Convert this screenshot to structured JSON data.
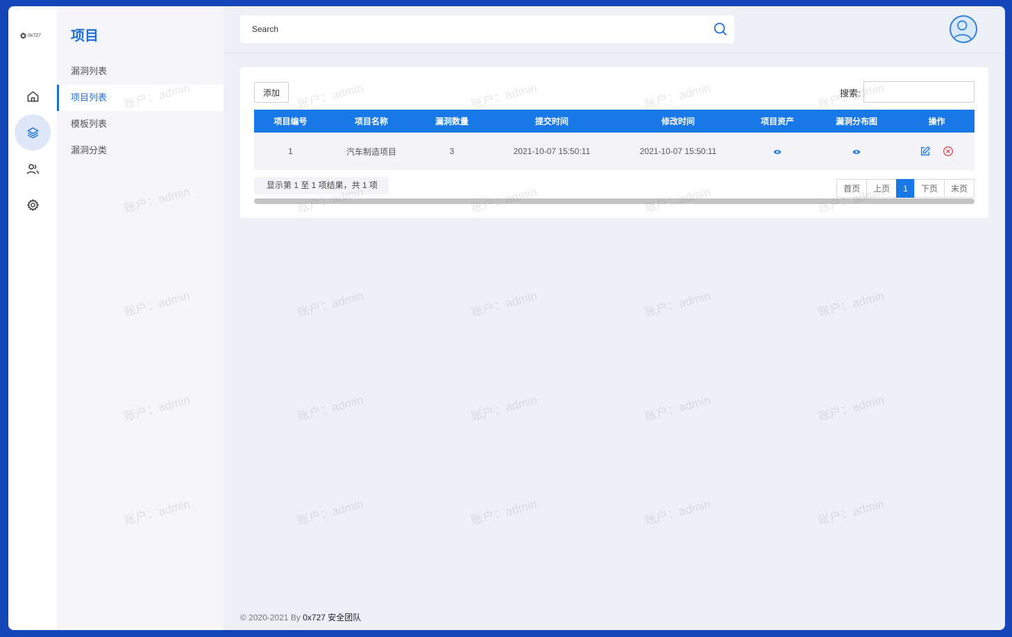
{
  "logo": {
    "text": "0x727"
  },
  "rail": [
    {
      "name": "home-icon",
      "active": false
    },
    {
      "name": "layers-icon",
      "active": true
    },
    {
      "name": "users-icon",
      "active": false
    },
    {
      "name": "gear-icon",
      "active": false
    }
  ],
  "subnav": {
    "title": "项目",
    "items": [
      "漏洞列表",
      "项目列表",
      "模板列表",
      "漏洞分类"
    ],
    "active_index": 1
  },
  "topbar": {
    "search_placeholder": "Search"
  },
  "toolbar": {
    "add_label": "添加",
    "search_label": "搜索:"
  },
  "table": {
    "columns": [
      "项目编号",
      "项目名称",
      "漏洞数量",
      "提交时间",
      "修改时间",
      "项目资产",
      "漏洞分布图",
      "操作"
    ],
    "rows": [
      {
        "id": "1",
        "name": "汽车制造项目",
        "vuln_count": "3",
        "submitted": "2021-10-07 15:50:11",
        "modified": "2021-10-07 15:50:11"
      }
    ]
  },
  "info_text": "显示第 1 至 1 项结果，共 1 项",
  "pagination": {
    "first": "首页",
    "prev": "上页",
    "current": "1",
    "next": "下页",
    "last": "末页"
  },
  "footer": {
    "copyright": "© 2020-2021 By ",
    "brand": "0x727 安全团队"
  },
  "watermark_text": "账户：admin",
  "colors": {
    "accent": "#1878e8",
    "frame": "#1446b8",
    "delete": "#e04848"
  }
}
